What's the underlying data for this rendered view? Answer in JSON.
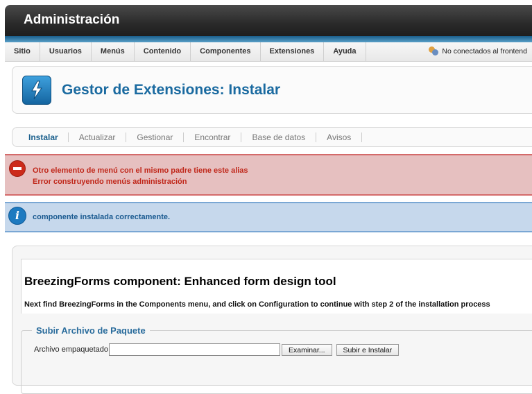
{
  "header": {
    "title": "Administración"
  },
  "menu": {
    "items": [
      "Sitio",
      "Usuarios",
      "Menús",
      "Contenido",
      "Componentes",
      "Extensiones",
      "Ayuda"
    ],
    "status": "No conectados al frontend"
  },
  "toolbar": {
    "title": "Gestor de Extensiones: Instalar",
    "icon": "lightning-icon"
  },
  "subnav": {
    "tabs": [
      "Instalar",
      "Actualizar",
      "Gestionar",
      "Encontrar",
      "Base de datos",
      "Avisos"
    ],
    "active": "Instalar"
  },
  "messages": {
    "error": [
      "Otro elemento de menú con el mismo padre tiene este alias",
      "Error construyendo menús administración"
    ],
    "info": "componente instalada correctamente."
  },
  "content": {
    "heading": "BreezingForms component: Enhanced form design tool",
    "description": "Next find BreezingForms in the Components menu, and click on Configuration to continue with step 2 of the installation process"
  },
  "upload": {
    "legend": "Subir Archivo de Paquete",
    "label": "Archivo empaquetado",
    "browse_label": "Examinar...",
    "submit_label": "Subir e Instalar"
  },
  "colors": {
    "accent": "#1a6aa0",
    "error": "#c0271a",
    "info": "#1a5a90"
  }
}
